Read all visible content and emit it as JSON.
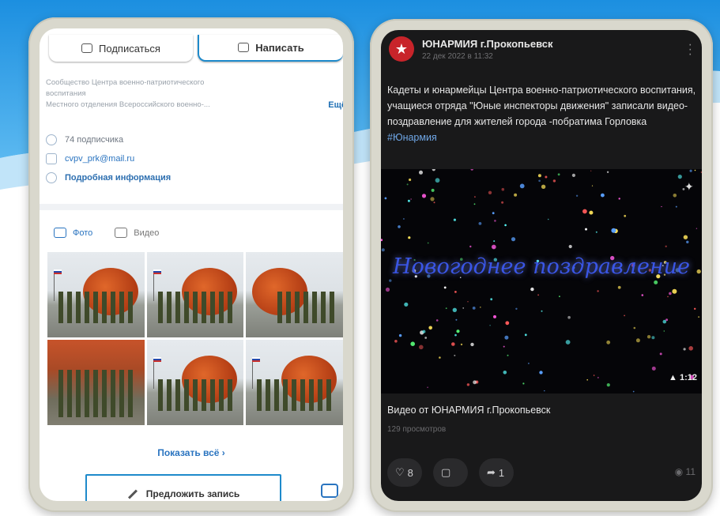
{
  "left_screen": {
    "subscribe_label": "Подписаться",
    "write_label": "Написать",
    "description_line1": "Сообщество Центра военно-патриотического",
    "description_line2": "воспитания",
    "description_line3": "Местного отделения Всероссийского военно-...",
    "more_label": "Ещё",
    "subscribers": "74 подписчика",
    "email": "cvpv_prk@mail.ru",
    "details_label": "Подробная информация",
    "tab_photo": "Фото",
    "tab_video": "Видео",
    "show_all": "Показать всё ›",
    "suggest_post": "Предложить запись"
  },
  "right_screen": {
    "author": "ЮНАРМИЯ г.Прокопьевск",
    "date": "22 дек 2022 в 11:32",
    "post_text": "Кадеты и юнармейцы Центра военно-патриотического воспитания, учащиеся отряда \"Юные инспекторы движения\" записали видео-поздравление для жителей города -побратима Горловка ",
    "hashtag": "#Юнармия",
    "video_title": "Новогоднее поздравление",
    "duration": "1:12",
    "video_caption": "Видео от ЮНАРМИЯ г.Прокопьевск",
    "views": "129 просмотров",
    "likes": "8",
    "reposts": "1",
    "view_count": "11"
  },
  "colors": {
    "accent_blue": "#1e8acb",
    "link_blue": "#2a74c0",
    "dark_bg": "#19191a",
    "avatar_red": "#c8242a"
  }
}
